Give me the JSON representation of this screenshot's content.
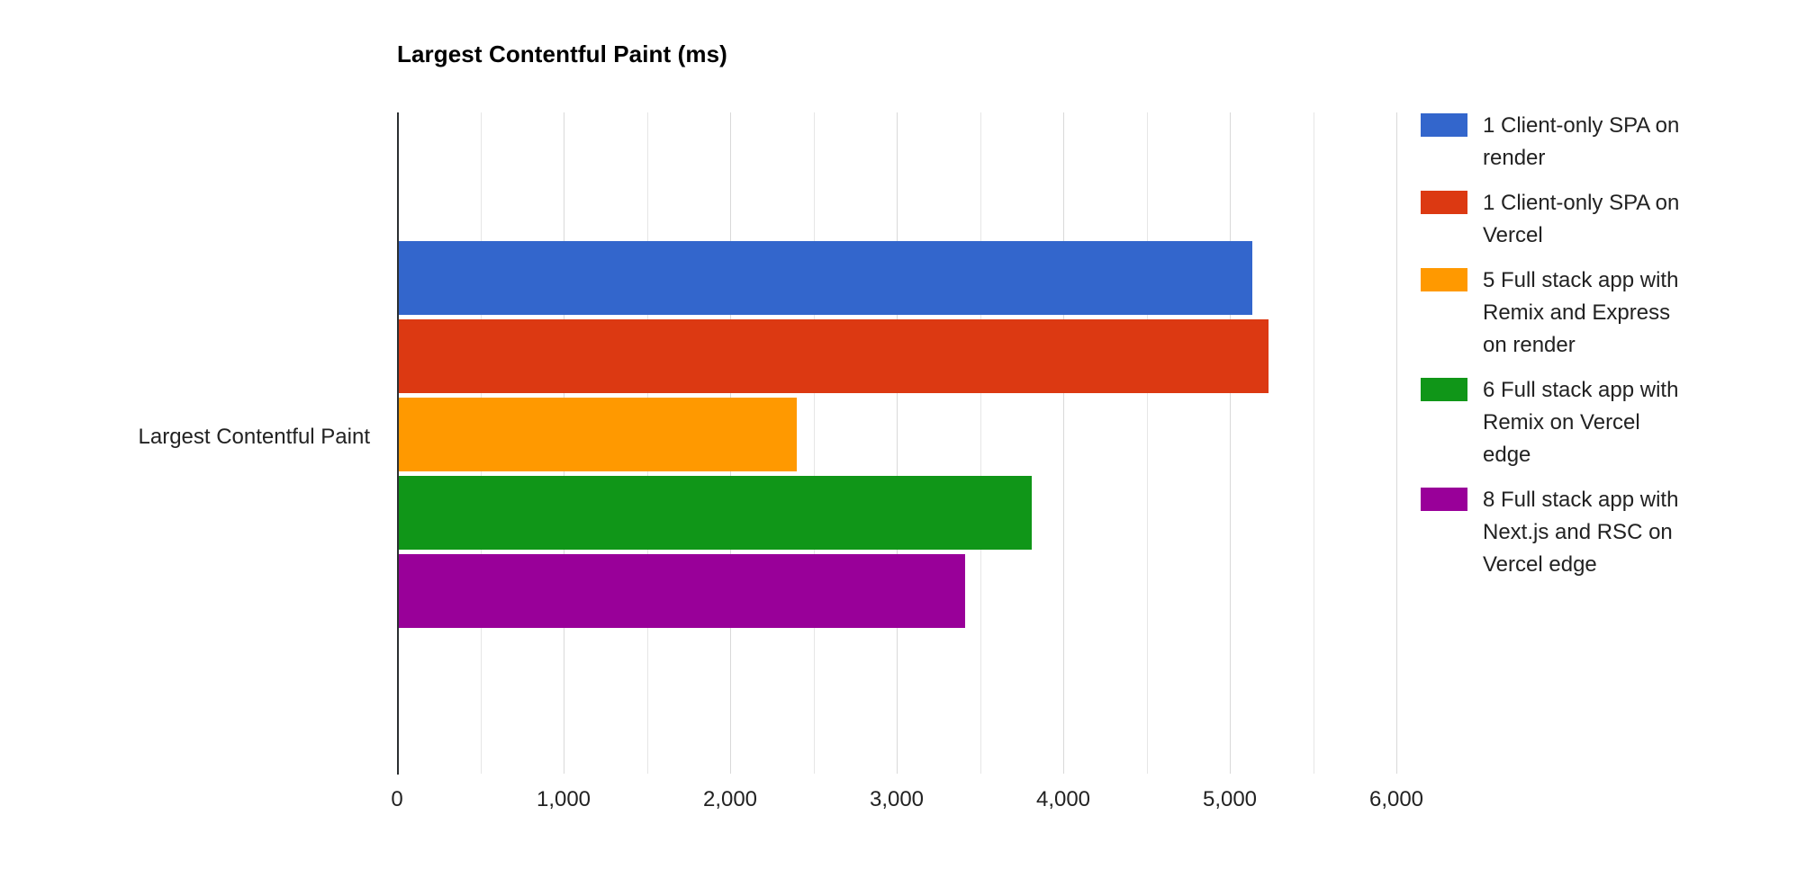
{
  "chart_data": {
    "type": "bar",
    "orientation": "horizontal",
    "title": "Largest Contentful Paint (ms)",
    "xlabel": "",
    "ylabel": "",
    "categories": [
      "Largest Contentful Paint"
    ],
    "xlim": [
      0,
      6000
    ],
    "grid": true,
    "major_ticks": [
      0,
      1000,
      2000,
      3000,
      4000,
      5000,
      6000
    ],
    "tick_labels": [
      "0",
      "1,000",
      "2,000",
      "3,000",
      "4,000",
      "5,000",
      "6,000"
    ],
    "minor_tick_step": 500,
    "legend_position": "right",
    "series": [
      {
        "name": "1 Client-only SPA on render",
        "color": "#3366cc",
        "values": [
          5135
        ]
      },
      {
        "name": "1 Client-only SPA on Vercel",
        "color": "#dc3912",
        "values": [
          5230
        ]
      },
      {
        "name": "5 Full stack app with Remix and Express on render",
        "color": "#ff9900",
        "values": [
          2400
        ]
      },
      {
        "name": "6 Full stack app with Remix on Vercel edge",
        "color": "#109618",
        "values": [
          3810
        ]
      },
      {
        "name": "8 Full stack app with Next.js and RSC on Vercel edge",
        "color": "#990099",
        "values": [
          3410
        ]
      }
    ]
  },
  "legend": {
    "items": [
      {
        "label": "1 Client-only SPA on render",
        "color": "#3366cc"
      },
      {
        "label": "1 Client-only SPA on Vercel",
        "color": "#dc3912"
      },
      {
        "label": "5 Full stack app with Remix and Express on render",
        "color": "#ff9900"
      },
      {
        "label": "6 Full stack app with Remix on Vercel edge",
        "color": "#109618"
      },
      {
        "label": "8 Full stack app with Next.js and RSC on Vercel edge",
        "color": "#990099"
      }
    ]
  },
  "axis": {
    "category_label": "Largest Contentful Paint",
    "x_tick_labels": [
      "0",
      "1,000",
      "2,000",
      "3,000",
      "4,000",
      "5,000",
      "6,000"
    ]
  },
  "colors": {
    "axis_line": "#2b2f31",
    "gridline_major": "#d9d9d9",
    "gridline_minor": "#e6e6e6",
    "text": "#222222",
    "title": "#000000",
    "background": "#ffffff"
  }
}
